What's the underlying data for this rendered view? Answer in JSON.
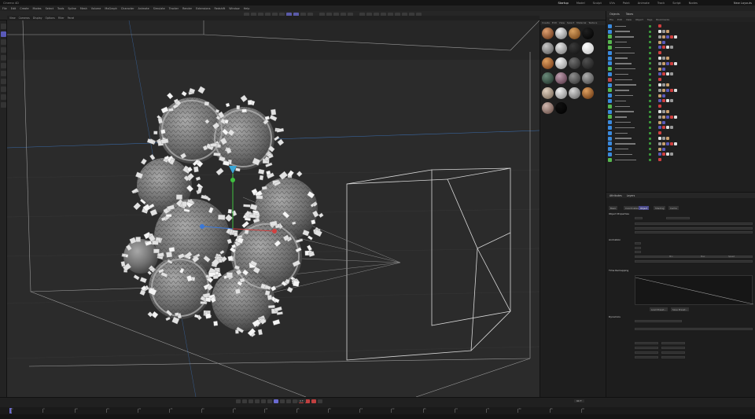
{
  "titlebar": {
    "title": "Cinema 4D",
    "layouts": [
      "Startup",
      "Model",
      "Sculpt",
      "UVs",
      "Paint",
      "Animate",
      "Track",
      "Script",
      "Nodes"
    ],
    "active_layout": "Startup",
    "new_layouts": "New Layouts"
  },
  "menubar": {
    "items": [
      "File",
      "Edit",
      "Create",
      "Modes",
      "Select",
      "Tools",
      "Spline",
      "Mesh",
      "Volume",
      "MoGraph",
      "Character",
      "Animate",
      "Simulate",
      "Tracker",
      "Render",
      "Extensions",
      "Redshift",
      "Window",
      "Help"
    ]
  },
  "viewport": {
    "menu": [
      "View",
      "Cameras",
      "Display",
      "Options",
      "Filter",
      "Panel"
    ],
    "label": "Perspective",
    "camera": "Default Camera"
  },
  "materials": {
    "tabs": [
      "Create",
      "Edit",
      "View",
      "Select",
      "Material",
      "Texture"
    ],
    "swatches": [
      {
        "a": "#e0a070",
        "b": "#5a2a10"
      },
      {
        "a": "#f0f0f0",
        "b": "#707070"
      },
      {
        "a": "#d8a060",
        "b": "#6a3a10"
      },
      {
        "a": "#202020",
        "b": "#000000"
      },
      {
        "a": "#c8c8c8",
        "b": "#505050"
      },
      {
        "a": "#e8e8e8",
        "b": "#707070"
      },
      {
        "a": "#3a3a3a",
        "b": "#101010"
      },
      {
        "a": "#ffffff",
        "b": "#bbbbbb"
      },
      {
        "a": "#e0a060",
        "b": "#6a3010"
      },
      {
        "a": "#f2f2f2",
        "b": "#8a8a8a"
      },
      {
        "a": "#707070",
        "b": "#202020"
      },
      {
        "a": "#505050",
        "b": "#181818"
      },
      {
        "a": "#6a8a7a",
        "b": "#1a2a22"
      },
      {
        "a": "#c0a0b0",
        "b": "#4a2a3a"
      },
      {
        "a": "#909090",
        "b": "#2a2a2a"
      },
      {
        "a": "#b0b0b0",
        "b": "#3a3a3a"
      },
      {
        "a": "#e0d0c0",
        "b": "#6a5a4a"
      },
      {
        "a": "#f0f0f0",
        "b": "#7a7a7a"
      },
      {
        "a": "#d8d8d8",
        "b": "#5a5a5a"
      },
      {
        "a": "#e0a060",
        "b": "#5a2a08"
      },
      {
        "a": "#d0b8b0",
        "b": "#5a4038"
      },
      {
        "a": "#101010",
        "b": "#000000"
      }
    ]
  },
  "objects": {
    "tabs": [
      "Objects",
      "Takes"
    ],
    "menu": [
      "File",
      "Edit",
      "View",
      "Object",
      "Tags",
      "Bookmarks"
    ],
    "rows": [
      {
        "color": "#e0e0e0",
        "icon": "#3a8adf"
      },
      {
        "color": "#e0e0e0",
        "icon": "#3a8adf"
      },
      {
        "color": "#e0e0e0",
        "icon": "#56b84e"
      },
      {
        "color": "#e0e0e0",
        "icon": "#56b84e"
      },
      {
        "color": "#e0e0e0",
        "icon": "#56b84e"
      },
      {
        "color": "#e0e0e0",
        "icon": "#3a8adf"
      },
      {
        "color": "#e0e0e0",
        "icon": "#3a8adf"
      },
      {
        "color": "#e0e0e0",
        "icon": "#3a8adf"
      },
      {
        "color": "#e0e0e0",
        "icon": "#56b84e"
      },
      {
        "color": "#e0e0e0",
        "icon": "#3a8adf"
      },
      {
        "color": "#e0e0e0",
        "icon": "#c04848"
      },
      {
        "color": "#e0e0e0",
        "icon": "#3a8adf"
      },
      {
        "color": "#e0e0e0",
        "icon": "#56b84e"
      },
      {
        "color": "#e0e0e0",
        "icon": "#3a8adf"
      },
      {
        "color": "#e0e0e0",
        "icon": "#3a8adf"
      },
      {
        "color": "#e0e0e0",
        "icon": "#56b84e"
      },
      {
        "color": "#e0e0e0",
        "icon": "#3a8adf"
      },
      {
        "color": "#e0e0e0",
        "icon": "#56b84e"
      },
      {
        "color": "#e0e0e0",
        "icon": "#3a8adf"
      },
      {
        "color": "#e0e0e0",
        "icon": "#3a8adf"
      },
      {
        "color": "#e0e0e0",
        "icon": "#3a8adf"
      },
      {
        "color": "#e0e0e0",
        "icon": "#3a8adf"
      },
      {
        "color": "#e0e0e0",
        "icon": "#3a8adf"
      },
      {
        "color": "#e0e0e0",
        "icon": "#3a8adf"
      },
      {
        "color": "#e0e0e0",
        "icon": "#3a8adf"
      },
      {
        "color": "#e0e0e0",
        "icon": "#56b84e"
      }
    ]
  },
  "attributes": {
    "tabs": [
      "Attributes",
      "Layers"
    ],
    "object_tabs": [
      "Basic",
      "Coordinates",
      "Object",
      "Shading",
      "Cache"
    ],
    "active_tab": "Object",
    "section_object": "Object Properties",
    "section_animation": "Animation",
    "section_time": "Time Remapping",
    "section_dynamics": "Dynamics",
    "graph_buttons": [
      "Load Preset...",
      "Save Preset..."
    ],
    "slider_labels": [
      "Min",
      "Max",
      "Speed"
    ]
  },
  "timeline": {
    "frame_field": "0 F",
    "end_field": "90 F",
    "ticks": [
      "0",
      "5",
      "10",
      "15",
      "20",
      "25",
      "30",
      "35",
      "40",
      "45",
      "50",
      "55",
      "60",
      "65",
      "70",
      "75",
      "80",
      "85",
      "90"
    ]
  },
  "colors": {
    "accent": "#5a5ab8",
    "x_axis": "#d04040",
    "y_axis": "#40c040",
    "z_axis": "#3a78d8",
    "viewport_bg": "#2d2d2d"
  }
}
